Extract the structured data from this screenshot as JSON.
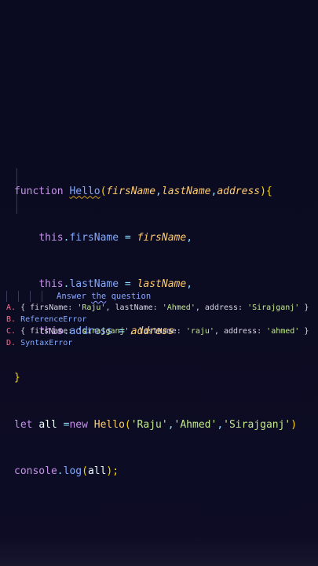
{
  "code": {
    "line1": {
      "kw": "function",
      "name": "Hello",
      "open": "(",
      "p1": "firsName",
      "c1": ",",
      "p2": "lastName",
      "c2": ",",
      "p3": "address",
      "close": "){"
    },
    "line2": {
      "this": "this",
      "dot": ".",
      "prop": "firsName",
      "eq": " = ",
      "val": "firsName",
      "end": ","
    },
    "line3": {
      "this": "this",
      "dot": ".",
      "prop": "lastName",
      "eq": " = ",
      "val": "lastName",
      "end": ","
    },
    "line4": {
      "this": "this",
      "dot": ".",
      "prop": "address",
      "eq": " = ",
      "val": "address",
      "end": ""
    },
    "line5": {
      "brace": "}"
    },
    "line6": {
      "kw": "let",
      "var": "all",
      "eq": " =",
      "new": "new",
      "cls": "Hello",
      "open": "(",
      "a1": "'Raju'",
      "c1": ",",
      "a2": "'Ahmed'",
      "c2": ",",
      "a3": "'Sirajganj'",
      "close": ")"
    },
    "line7": {
      "obj": "console",
      "dot": ".",
      "fn": "log",
      "open": "(",
      "arg": "all",
      "close": ");"
    }
  },
  "question": {
    "heading_a": "Answer",
    "heading_b": "the",
    "heading_c": "question"
  },
  "options": [
    {
      "letter": "A.",
      "text_a": " { firsName: ",
      "v1": "'Raju'",
      "text_b": ", lastName: ",
      "v2": "'Ahmed'",
      "text_c": ", address: ",
      "v3": "'Sirajganj'",
      "text_d": " }"
    },
    {
      "letter": "B.",
      "text": " ReferenceError"
    },
    {
      "letter": "C.",
      "text_a": " { firsName: ",
      "v1": "'sirajganj'",
      "text_b": ", lastName: ",
      "v2": "'raju'",
      "text_c": ", address: ",
      "v3": "'ahmed'",
      "text_d": " }"
    },
    {
      "letter": "D.",
      "text": " SyntaxError"
    }
  ],
  "colors": {
    "background": "#0b0b22",
    "keyword": "#c792ea",
    "function": "#82aaff",
    "param": "#f78c6c",
    "string": "#c3e88d",
    "brace": "#ffd700",
    "option_letter": "#ff6b8b"
  }
}
